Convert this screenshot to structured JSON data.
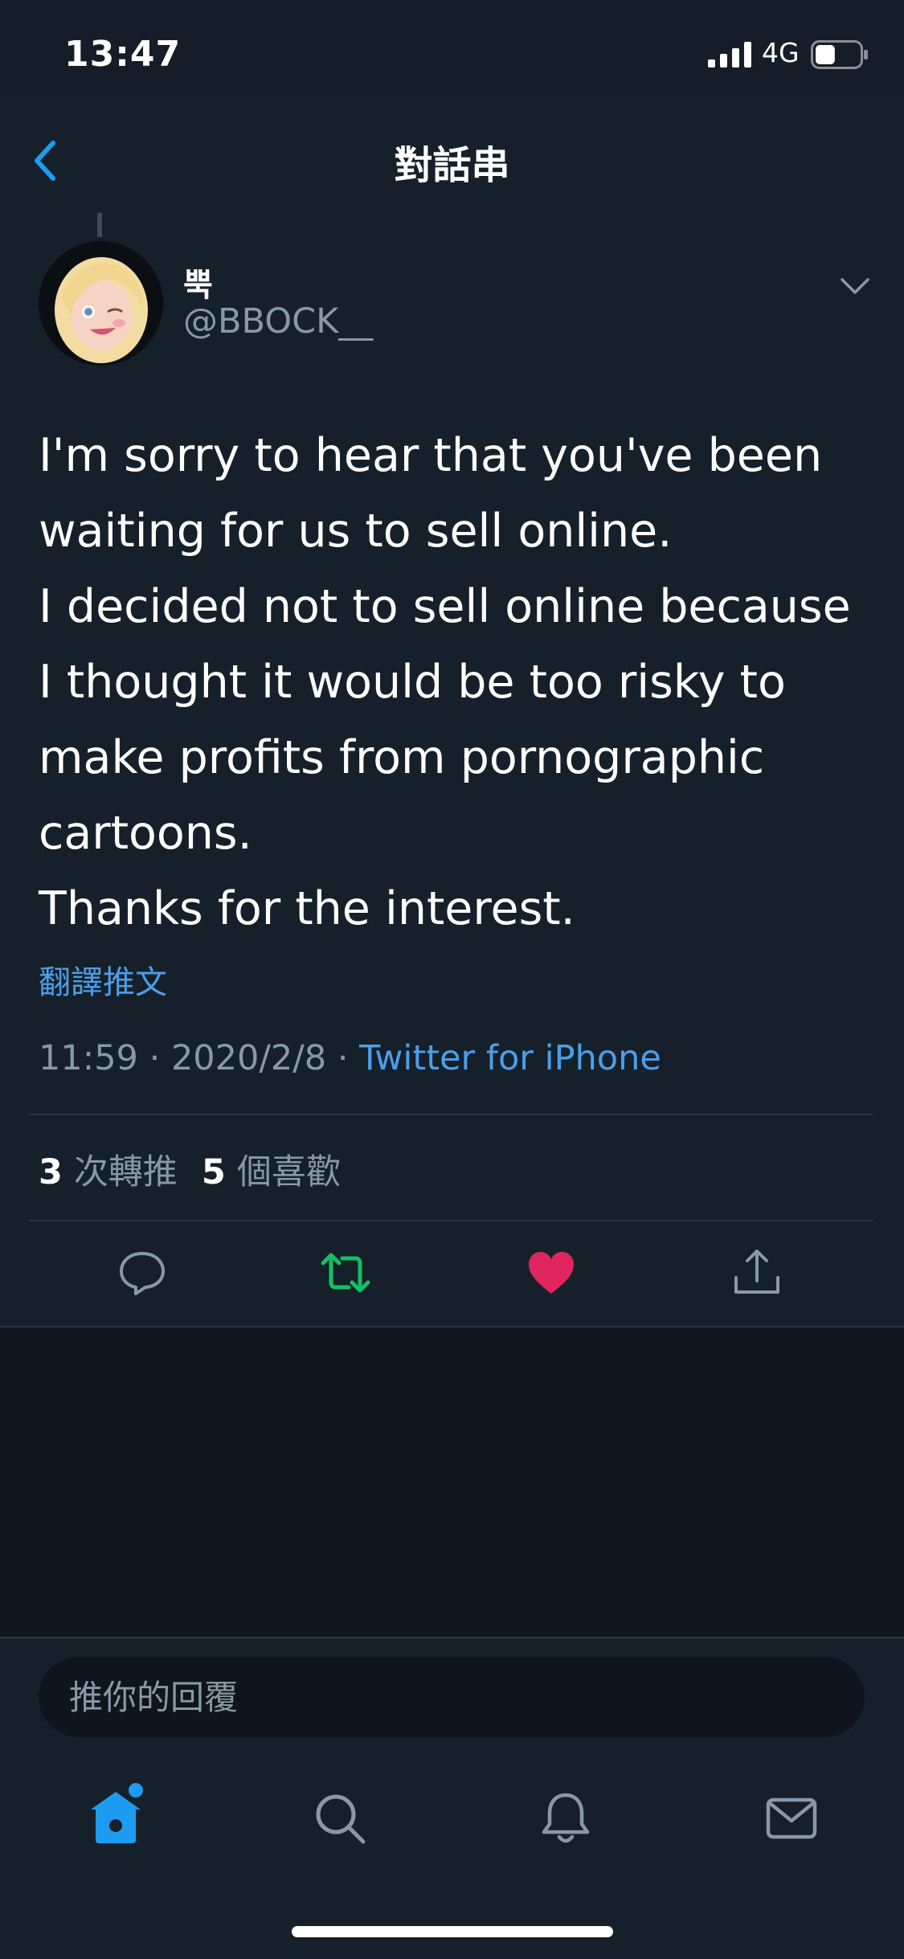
{
  "status_bar": {
    "time": "13:47",
    "network": "4G",
    "battery_level": 0.45
  },
  "header": {
    "title": "對話串",
    "back_icon": "chevron-left-icon"
  },
  "tweet": {
    "display_name": "뿍",
    "handle": "@BBOCK__",
    "text_lines": [
      "I'm sorry to hear that you've been waiting for us to sell online.",
      "I decided not to sell online because I thought it would be too risky to make profits from pornographic cartoons.",
      "Thanks for the interest."
    ],
    "translate_label": "翻譯推文",
    "time": "11:59",
    "date": "2020/2/8",
    "separator": "·",
    "source": "Twitter for iPhone",
    "retweet_count": "3",
    "retweet_label": "次轉推",
    "like_count": "5",
    "like_label": "個喜歡"
  },
  "actions": {
    "reply_icon": "reply-icon",
    "retweet_icon": "retweet-icon",
    "like_icon": "heart-icon",
    "share_icon": "share-icon",
    "retweet_color": "#17bf63",
    "like_color": "#e0245e"
  },
  "composer": {
    "placeholder": "推你的回覆",
    "value": ""
  },
  "tab_bar": {
    "tabs": [
      "home",
      "search",
      "notifications",
      "messages"
    ],
    "active": "home",
    "accent_color": "#1da1f2"
  }
}
